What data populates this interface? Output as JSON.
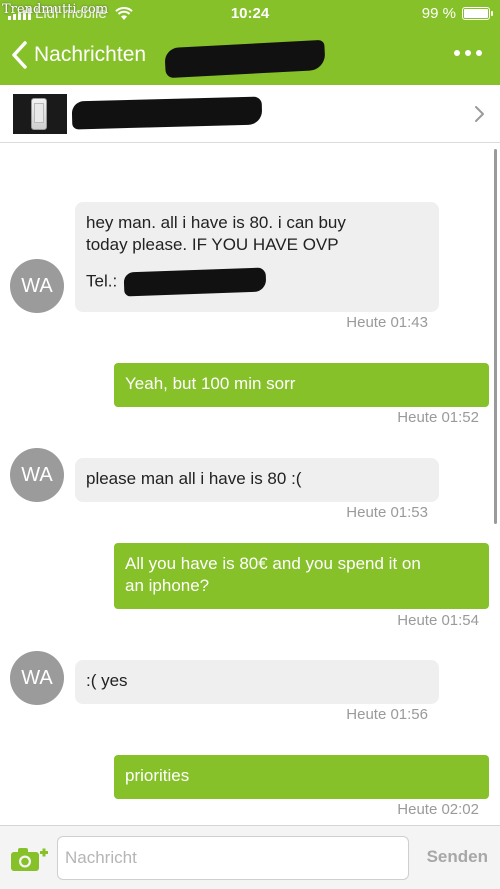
{
  "watermark": "Trendmutti.com",
  "status_bar": {
    "carrier": "Lidl mobile",
    "time": "10:24",
    "battery": "99 %",
    "battery_level": 0.99
  },
  "nav": {
    "back_label": "Nachrichten"
  },
  "colors": {
    "accent": "#86c12a",
    "incoming_bubble": "#efefef",
    "avatar": "#9b9b9b",
    "timestamp": "#9a9a9a"
  },
  "messages": [
    {
      "direction": "in",
      "avatar": "WA",
      "line1": "hey man. all i have is 80. i can buy",
      "line2": "today please. IF YOU HAVE OVP",
      "tel_label": "Tel.:",
      "time": "Heute 01:43"
    },
    {
      "direction": "out",
      "text": "Yeah, but 100 min sorr",
      "time": "Heute 01:52"
    },
    {
      "direction": "in",
      "avatar": "WA",
      "text": "please man all i have is 80 :(",
      "time": "Heute 01:53"
    },
    {
      "direction": "out",
      "line1": "All you have is 80€ and you spend it on",
      "line2": "an iphone?",
      "time": "Heute 01:54"
    },
    {
      "direction": "in",
      "avatar": "WA",
      "text": ":( yes",
      "time": "Heute 01:56"
    },
    {
      "direction": "out",
      "text": "priorities",
      "time": "Heute 02:02"
    }
  ],
  "composer": {
    "placeholder": "Nachricht",
    "send_label": "Senden"
  },
  "icons": [
    "wifi-icon",
    "battery-icon",
    "back-chevron-icon",
    "more-icon",
    "chevron-right-icon",
    "camera-add-icon"
  ]
}
